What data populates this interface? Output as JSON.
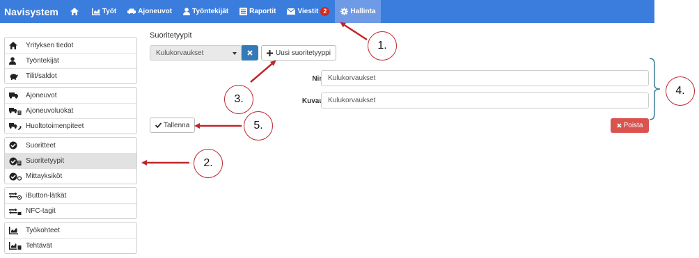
{
  "navbar": {
    "brand": "Navisystem",
    "items": [
      {
        "label": "",
        "icon": "home-icon"
      },
      {
        "label": "Työt",
        "icon": "chart-icon"
      },
      {
        "label": "Ajoneuvot",
        "icon": "car-icon"
      },
      {
        "label": "Työntekijät",
        "icon": "user-icon"
      },
      {
        "label": "Raportit",
        "icon": "list-icon"
      },
      {
        "label": "Viestit",
        "icon": "envelope-icon",
        "badge": "2"
      },
      {
        "label": "Hallinta",
        "icon": "gear-icon",
        "active": true
      }
    ]
  },
  "sidebar": {
    "groups": [
      [
        {
          "label": "Yrityksen tiedot",
          "icon": "home-icon"
        },
        {
          "label": "Työntekijät",
          "icon": "user-icon"
        },
        {
          "label": "Tilit/saldot",
          "icon": "piggy-bank-icon"
        }
      ],
      [
        {
          "label": "Ajoneuvot",
          "icon": "truck-icon"
        },
        {
          "label": "Ajoneuvoluokat",
          "icon": "truck-class-icon"
        },
        {
          "label": "Huoltotoimenpiteet",
          "icon": "truck-wrench-icon"
        }
      ],
      [
        {
          "label": "Suoritteet",
          "icon": "check-circle-icon"
        },
        {
          "label": "Suoritetyypit",
          "icon": "check-circle-list-icon",
          "active": true
        },
        {
          "label": "Mittayksiköt",
          "icon": "check-circle-unit-icon"
        }
      ],
      [
        {
          "label": "iButton-lätkät",
          "icon": "transfer-ibutton-icon"
        },
        {
          "label": "NFC-tagit",
          "icon": "transfer-nfc-icon"
        }
      ],
      [
        {
          "label": "Työkohteet",
          "icon": "chart-icon"
        },
        {
          "label": "Tehtävät",
          "icon": "chart-task-icon"
        }
      ]
    ]
  },
  "main": {
    "heading": "Suoritetyypit",
    "select_value": "Kulukorvaukset",
    "new_button": "Uusi suoritetyyppi",
    "fields": {
      "name_label": "Nimi",
      "name_value": "Kulukorvaukset",
      "desc_label": "Kuvaus",
      "desc_value": "Kulukorvaukset"
    },
    "save_button": "Tallenna",
    "delete_button": "Poista"
  },
  "annotations": [
    "1.",
    "2.",
    "3.",
    "4.",
    "5."
  ],
  "colors": {
    "navbar": "#3b7ddd",
    "primary": "#337ab7",
    "danger": "#d9534f",
    "annotation": "#c0262a"
  }
}
